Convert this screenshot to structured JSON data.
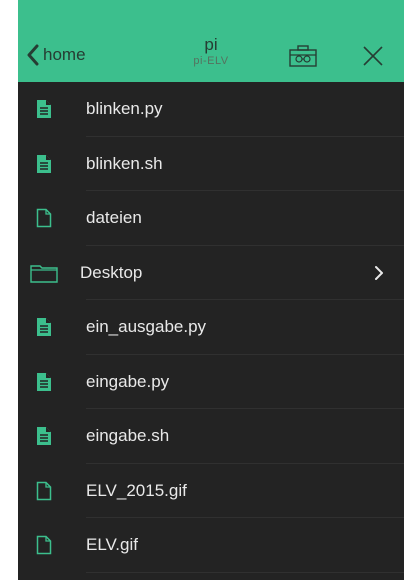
{
  "header": {
    "back_label": "home",
    "title": "pi",
    "subtitle": "pi-ELV"
  },
  "colors": {
    "accent": "#3cbf8d",
    "background": "#232323",
    "text": "#e9e9e9",
    "header_text": "#263d33"
  },
  "files": [
    {
      "name": "blinken.py",
      "icon": "text-file-icon"
    },
    {
      "name": "blinken.sh",
      "icon": "text-file-icon"
    },
    {
      "name": "dateien",
      "icon": "blank-file-icon"
    },
    {
      "name": "Desktop",
      "icon": "folder-icon"
    },
    {
      "name": "ein_ausgabe.py",
      "icon": "text-file-icon"
    },
    {
      "name": "eingabe.py",
      "icon": "text-file-icon"
    },
    {
      "name": "eingabe.sh",
      "icon": "text-file-icon"
    },
    {
      "name": "ELV_2015.gif",
      "icon": "blank-file-icon"
    },
    {
      "name": "ELV.gif",
      "icon": "blank-file-icon"
    }
  ]
}
